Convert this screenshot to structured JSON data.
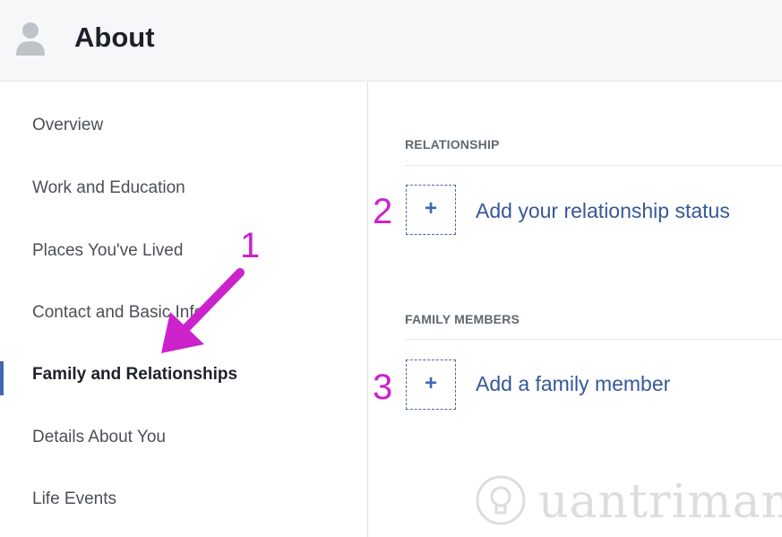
{
  "header": {
    "title": "About",
    "icon": "user-silhouette-icon"
  },
  "sidebar": {
    "items": [
      {
        "label": "Overview",
        "active": false
      },
      {
        "label": "Work and Education",
        "active": false
      },
      {
        "label": "Places You've Lived",
        "active": false
      },
      {
        "label": "Contact and Basic Info",
        "active": false
      },
      {
        "label": "Family and Relationships",
        "active": true
      },
      {
        "label": "Details About You",
        "active": false
      },
      {
        "label": "Life Events",
        "active": false
      }
    ]
  },
  "content": {
    "relationship": {
      "header": "RELATIONSHIP",
      "add_symbol": "+",
      "add_label": "Add your relationship status"
    },
    "family": {
      "header": "FAMILY MEMBERS",
      "add_symbol": "+",
      "add_label": "Add a family member"
    }
  },
  "annotations": {
    "step1": "1",
    "step2": "2",
    "step3": "3",
    "color": "#cc22cc"
  },
  "watermark": {
    "text": "uantrimang",
    "icon": "lightbulb-icon"
  },
  "colors": {
    "accent": "#4267b2",
    "link": "#365899",
    "header_bg": "#f6f7f9"
  }
}
